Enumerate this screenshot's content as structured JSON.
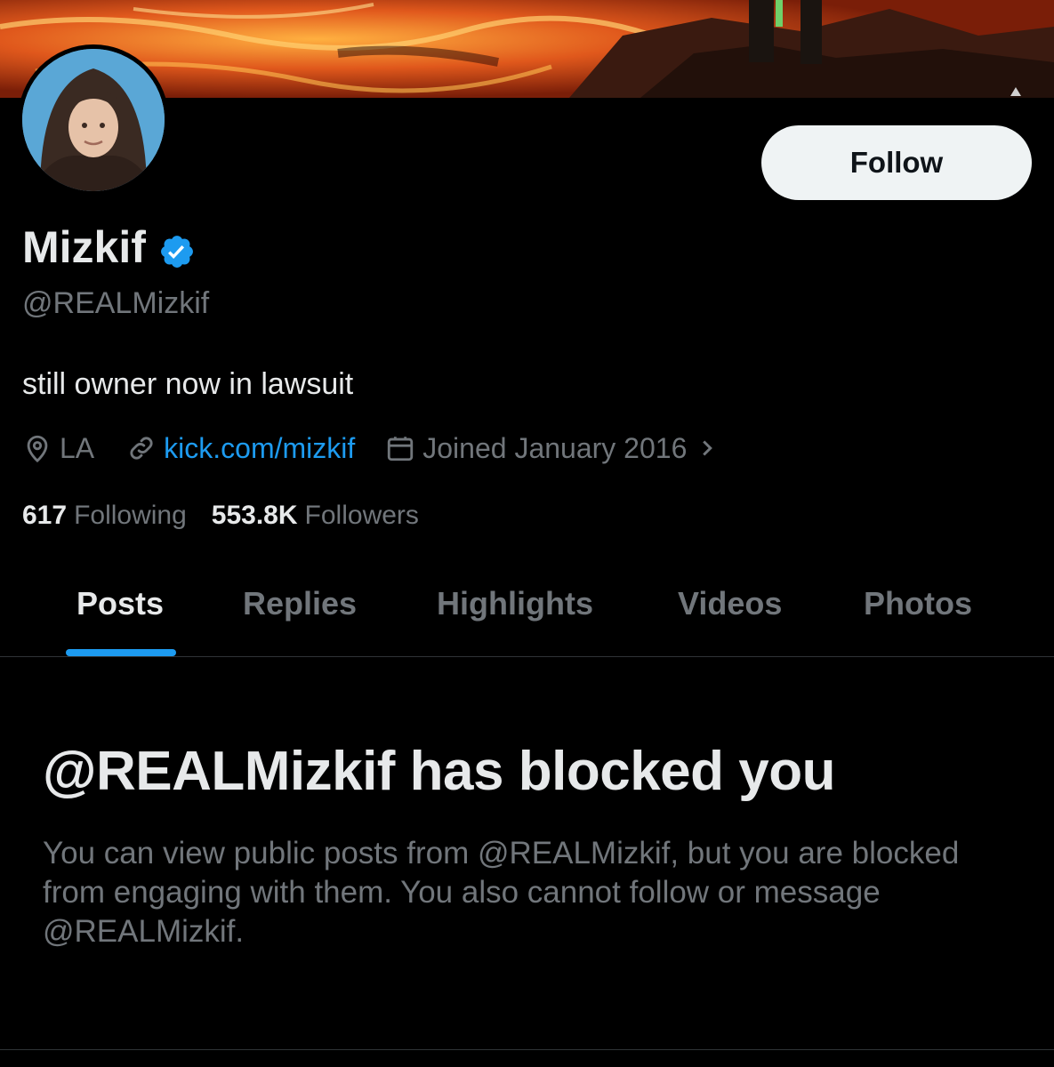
{
  "profile": {
    "display_name": "Mizkif",
    "handle": "@REALMizkif",
    "bio": "still owner now in lawsuit",
    "location": "LA",
    "website": "kick.com/mizkif",
    "joined": "Joined January 2016",
    "following_count": "617",
    "following_label": "Following",
    "followers_count": "553.8K",
    "followers_label": "Followers"
  },
  "actions": {
    "follow_label": "Follow"
  },
  "tabs": [
    {
      "label": "Posts",
      "active": true
    },
    {
      "label": "Replies",
      "active": false
    },
    {
      "label": "Highlights",
      "active": false
    },
    {
      "label": "Videos",
      "active": false
    },
    {
      "label": "Photos",
      "active": false
    }
  ],
  "blocked": {
    "title": "@REALMizkif has blocked you",
    "description": "You can view public posts from @REALMizkif, but you are blocked from engaging with them. You also cannot follow or message @REALMizkif."
  },
  "icons": {
    "verified": "verified-badge-icon",
    "location": "location-pin-icon",
    "link": "link-icon",
    "calendar": "calendar-icon",
    "chevron": "chevron-right-icon"
  },
  "colors": {
    "background": "#000000",
    "accent": "#1d9bf0",
    "primary_text": "#e7e9ea",
    "secondary_text": "#71767b",
    "follow_button_bg": "#eff3f4"
  }
}
